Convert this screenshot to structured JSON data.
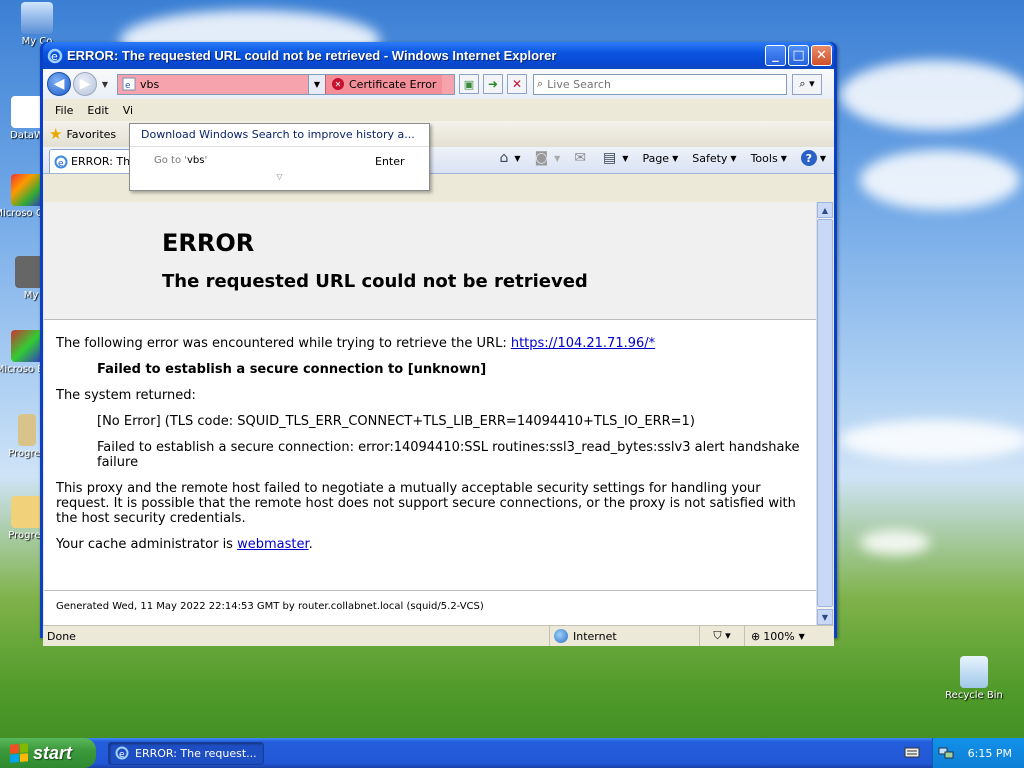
{
  "desktop": {
    "icons": [
      {
        "label": "My Co"
      },
      {
        "label": "DataW"
      },
      {
        "label": "Microso C++"
      },
      {
        "label": "My"
      },
      {
        "label": "Microso Basi"
      },
      {
        "label": "Progres"
      },
      {
        "label": "Progres"
      }
    ],
    "recycle_bin": "Recycle Bin"
  },
  "window": {
    "title": "ERROR: The requested URL could not be retrieved - Windows Internet Explorer",
    "address": {
      "value": "vbs",
      "cert_error": "Certificate Error"
    },
    "search": {
      "placeholder": "Live Search"
    },
    "menu": [
      "File",
      "Edit",
      "Vi"
    ],
    "favorites": "Favorites",
    "tab_title": "ERROR: The requested URL could not be retrieved",
    "commands": {
      "page": "Page",
      "safety": "Safety",
      "tools": "Tools"
    },
    "dropdown": {
      "suggestion": "Download Windows Search to improve history a...",
      "goto_prefix": "Go to '",
      "goto_value": "vbs",
      "goto_suffix": "'",
      "enter": "Enter"
    },
    "status": {
      "text": "Done",
      "zone": "Internet",
      "zoom": "100%"
    }
  },
  "page": {
    "h1": "ERROR",
    "h2": "The requested URL could not be retrieved",
    "p1": "The following error was encountered while trying to retrieve the URL: ",
    "p1_link": "https://104.21.71.96/*",
    "p2": "Failed to establish a secure connection to [unknown]",
    "p3": "The system returned:",
    "p4": "[No Error] (TLS code: SQUID_TLS_ERR_CONNECT+TLS_LIB_ERR=14094410+TLS_IO_ERR=1)",
    "p5": "Failed to establish a secure connection: error:14094410:SSL routines:ssl3_read_bytes:sslv3 alert handshake failure",
    "p6": "This proxy and the remote host failed to negotiate a mutually acceptable security settings for handling your request. It is possible that the remote host does not support secure connections, or the proxy is not satisfied with the host security credentials.",
    "p7": "Your cache administrator is ",
    "p7_link": "webmaster",
    "p7_end": ".",
    "footer": "Generated Wed, 11 May 2022 22:14:53 GMT by router.collabnet.local (squid/5.2-VCS)"
  },
  "taskbar": {
    "start": "start",
    "item": "ERROR: The request...",
    "clock": "6:15 PM"
  }
}
